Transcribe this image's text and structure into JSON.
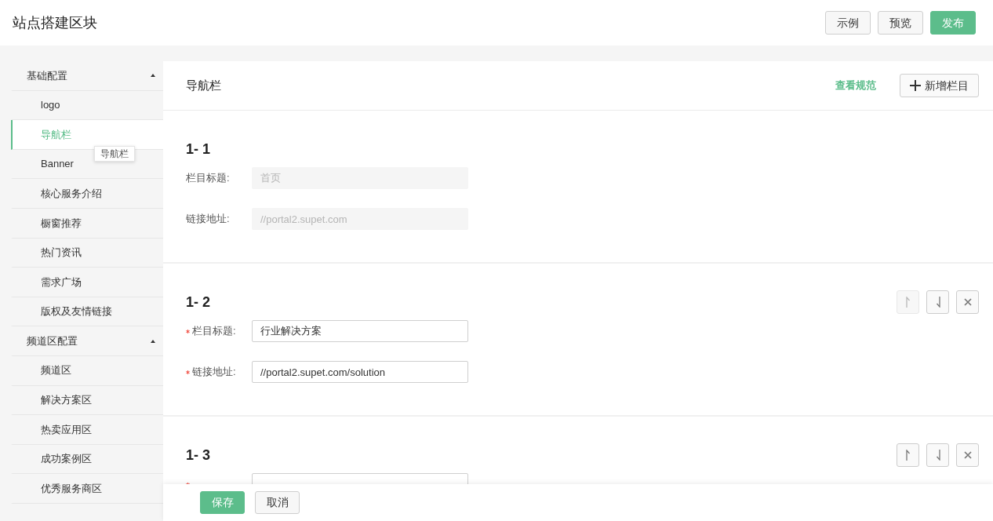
{
  "header": {
    "title": "站点搭建区块",
    "buttons": [
      {
        "label": "示例",
        "kind": "default"
      },
      {
        "label": "预览",
        "kind": "default"
      },
      {
        "label": "发布",
        "kind": "primary"
      }
    ]
  },
  "sidebar": {
    "groups": [
      {
        "label": "基础配置",
        "expanded": true,
        "children": [
          {
            "label": "logo",
            "selected": false
          },
          {
            "label": "导航栏",
            "selected": true
          },
          {
            "label": "Banner",
            "selected": false
          },
          {
            "label": "核心服务介绍",
            "selected": false
          },
          {
            "label": "橱窗推荐",
            "selected": false
          },
          {
            "label": "热门资讯",
            "selected": false
          },
          {
            "label": "需求广场",
            "selected": false
          },
          {
            "label": "版权及友情链接",
            "selected": false
          }
        ]
      },
      {
        "label": "频道区配置",
        "expanded": true,
        "children": [
          {
            "label": "频道区",
            "selected": false
          },
          {
            "label": "解决方案区",
            "selected": false
          },
          {
            "label": "热卖应用区",
            "selected": false
          },
          {
            "label": "成功案例区",
            "selected": false
          },
          {
            "label": "优秀服务商区",
            "selected": false
          }
        ]
      }
    ]
  },
  "tooltip": {
    "text": "导航栏"
  },
  "panel": {
    "title": "导航栏",
    "link": "查看规范",
    "add_button": {
      "label": "新增栏目"
    },
    "sections": [
      {
        "heading": "1- 1",
        "fields": [
          {
            "label": "栏目标题:",
            "required": false,
            "value": "首页",
            "disabled": true
          },
          {
            "label": "链接地址:",
            "required": false,
            "value": "//portal2.supet.com",
            "disabled": true
          }
        ]
      },
      {
        "heading": "1- 2",
        "actions": [
          {
            "kind": "up",
            "disabled": true
          },
          {
            "kind": "down",
            "disabled": false
          },
          {
            "kind": "delete",
            "disabled": false
          }
        ],
        "fields": [
          {
            "label": "栏目标题:",
            "required": true,
            "value": "行业解决方案",
            "disabled": false
          },
          {
            "label": "链接地址:",
            "required": true,
            "value": "//portal2.supet.com/solution",
            "disabled": false
          }
        ]
      },
      {
        "heading": "1- 3",
        "actions": [
          {
            "kind": "up",
            "disabled": false
          },
          {
            "kind": "down",
            "disabled": false
          },
          {
            "kind": "delete",
            "disabled": false
          }
        ],
        "fields": [
          {
            "required": true,
            "disabled": false
          }
        ]
      }
    ]
  },
  "footer": {
    "buttons": [
      {
        "label": "保存",
        "kind": "primary"
      },
      {
        "label": "取消",
        "kind": "default"
      }
    ]
  }
}
